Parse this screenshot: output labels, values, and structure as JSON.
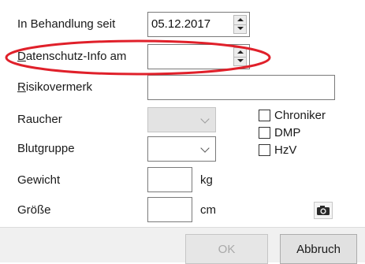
{
  "form": {
    "in_behandlung_label": "In Behandlung seit",
    "in_behandlung_value": "05.12.2017",
    "datenschutz_label_first": "D",
    "datenschutz_label_rest": "atenschutz-Info am",
    "datenschutz_value": "",
    "risikovermerk_label_first": "R",
    "risikovermerk_label_rest": "isikovermerk",
    "risikovermerk_value": "",
    "raucher_label": "Raucher",
    "raucher_value": "",
    "blutgruppe_label": "Blutgruppe",
    "blutgruppe_value": "",
    "gewicht_label": "Gewicht",
    "gewicht_value": "",
    "gewicht_unit": "kg",
    "groesse_label": "Größe",
    "groesse_value": "",
    "groesse_unit": "cm"
  },
  "checkboxes": [
    {
      "label": "Chroniker",
      "checked": false
    },
    {
      "label": "DMP",
      "checked": false
    },
    {
      "label": "HzV",
      "checked": false
    }
  ],
  "buttons": {
    "ok_label": "OK",
    "ok_enabled": false,
    "cancel_label": "Abbruch"
  },
  "icons": {
    "camera": "camera-icon",
    "spin": "spin-arrows-icon",
    "dropdown": "chevron-down-icon"
  },
  "colors": {
    "highlight": "#e0202a",
    "button_bg": "#e1e1e1",
    "disabled_text": "#a9a9a9"
  }
}
